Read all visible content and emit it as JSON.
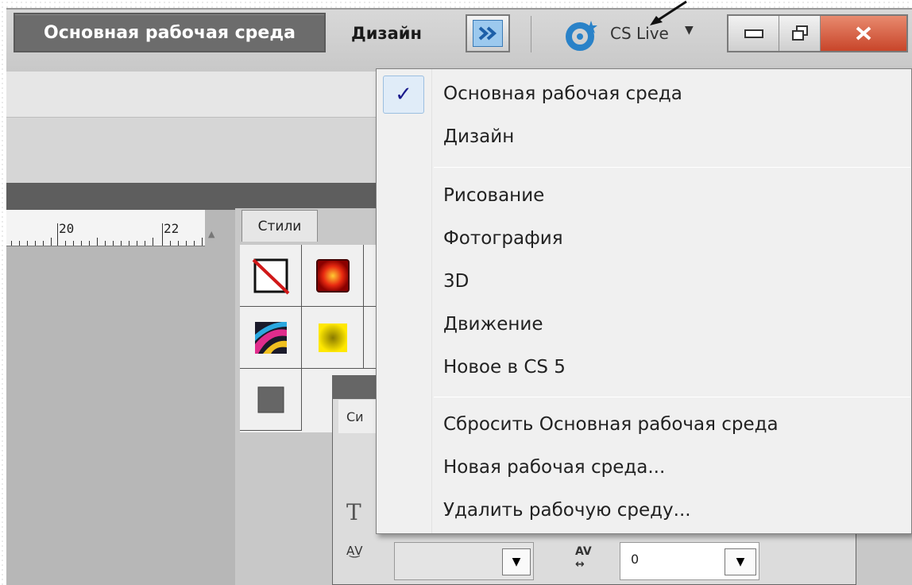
{
  "appbar": {
    "active_workspace": "Основная рабочая среда",
    "design_workspace": "Дизайн",
    "cs_live": "CS Live"
  },
  "ruler": {
    "labels": [
      "20",
      "22"
    ]
  },
  "styles_panel": {
    "tab_label": "Стили"
  },
  "char_panel": {
    "tab_label": "Си",
    "tracking_value": "0"
  },
  "menu": {
    "items_group1": [
      "Основная рабочая среда",
      "Дизайн"
    ],
    "items_group2": [
      "Рисование",
      "Фотография",
      "3D",
      "Движение",
      "Новое в CS 5"
    ],
    "items_group3": [
      "Сбросить Основная рабочая среда",
      "Новая рабочая среда...",
      "Удалить рабочую среду..."
    ],
    "checked_index": 0,
    "check_glyph": "✓"
  },
  "colors": {
    "accent": "#1a1a8c",
    "menu_bg": "#f0f0f0",
    "close_button": "#c8452a"
  },
  "icons": [
    "double-chevron-icon",
    "cs-live-icon",
    "minimize-icon",
    "restore-icon",
    "close-icon",
    "check-icon",
    "pointer-arrow-icon"
  ]
}
